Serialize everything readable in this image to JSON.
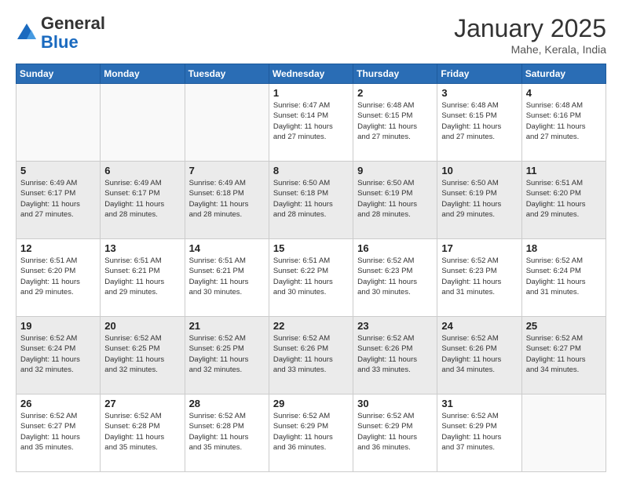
{
  "header": {
    "logo_general": "General",
    "logo_blue": "Blue",
    "month_title": "January 2025",
    "location": "Mahe, Kerala, India"
  },
  "days_of_week": [
    "Sunday",
    "Monday",
    "Tuesday",
    "Wednesday",
    "Thursday",
    "Friday",
    "Saturday"
  ],
  "weeks": [
    [
      {
        "day": "",
        "info": ""
      },
      {
        "day": "",
        "info": ""
      },
      {
        "day": "",
        "info": ""
      },
      {
        "day": "1",
        "info": "Sunrise: 6:47 AM\nSunset: 6:14 PM\nDaylight: 11 hours\nand 27 minutes."
      },
      {
        "day": "2",
        "info": "Sunrise: 6:48 AM\nSunset: 6:15 PM\nDaylight: 11 hours\nand 27 minutes."
      },
      {
        "day": "3",
        "info": "Sunrise: 6:48 AM\nSunset: 6:15 PM\nDaylight: 11 hours\nand 27 minutes."
      },
      {
        "day": "4",
        "info": "Sunrise: 6:48 AM\nSunset: 6:16 PM\nDaylight: 11 hours\nand 27 minutes."
      }
    ],
    [
      {
        "day": "5",
        "info": "Sunrise: 6:49 AM\nSunset: 6:17 PM\nDaylight: 11 hours\nand 27 minutes."
      },
      {
        "day": "6",
        "info": "Sunrise: 6:49 AM\nSunset: 6:17 PM\nDaylight: 11 hours\nand 28 minutes."
      },
      {
        "day": "7",
        "info": "Sunrise: 6:49 AM\nSunset: 6:18 PM\nDaylight: 11 hours\nand 28 minutes."
      },
      {
        "day": "8",
        "info": "Sunrise: 6:50 AM\nSunset: 6:18 PM\nDaylight: 11 hours\nand 28 minutes."
      },
      {
        "day": "9",
        "info": "Sunrise: 6:50 AM\nSunset: 6:19 PM\nDaylight: 11 hours\nand 28 minutes."
      },
      {
        "day": "10",
        "info": "Sunrise: 6:50 AM\nSunset: 6:19 PM\nDaylight: 11 hours\nand 29 minutes."
      },
      {
        "day": "11",
        "info": "Sunrise: 6:51 AM\nSunset: 6:20 PM\nDaylight: 11 hours\nand 29 minutes."
      }
    ],
    [
      {
        "day": "12",
        "info": "Sunrise: 6:51 AM\nSunset: 6:20 PM\nDaylight: 11 hours\nand 29 minutes."
      },
      {
        "day": "13",
        "info": "Sunrise: 6:51 AM\nSunset: 6:21 PM\nDaylight: 11 hours\nand 29 minutes."
      },
      {
        "day": "14",
        "info": "Sunrise: 6:51 AM\nSunset: 6:21 PM\nDaylight: 11 hours\nand 30 minutes."
      },
      {
        "day": "15",
        "info": "Sunrise: 6:51 AM\nSunset: 6:22 PM\nDaylight: 11 hours\nand 30 minutes."
      },
      {
        "day": "16",
        "info": "Sunrise: 6:52 AM\nSunset: 6:23 PM\nDaylight: 11 hours\nand 30 minutes."
      },
      {
        "day": "17",
        "info": "Sunrise: 6:52 AM\nSunset: 6:23 PM\nDaylight: 11 hours\nand 31 minutes."
      },
      {
        "day": "18",
        "info": "Sunrise: 6:52 AM\nSunset: 6:24 PM\nDaylight: 11 hours\nand 31 minutes."
      }
    ],
    [
      {
        "day": "19",
        "info": "Sunrise: 6:52 AM\nSunset: 6:24 PM\nDaylight: 11 hours\nand 32 minutes."
      },
      {
        "day": "20",
        "info": "Sunrise: 6:52 AM\nSunset: 6:25 PM\nDaylight: 11 hours\nand 32 minutes."
      },
      {
        "day": "21",
        "info": "Sunrise: 6:52 AM\nSunset: 6:25 PM\nDaylight: 11 hours\nand 32 minutes."
      },
      {
        "day": "22",
        "info": "Sunrise: 6:52 AM\nSunset: 6:26 PM\nDaylight: 11 hours\nand 33 minutes."
      },
      {
        "day": "23",
        "info": "Sunrise: 6:52 AM\nSunset: 6:26 PM\nDaylight: 11 hours\nand 33 minutes."
      },
      {
        "day": "24",
        "info": "Sunrise: 6:52 AM\nSunset: 6:26 PM\nDaylight: 11 hours\nand 34 minutes."
      },
      {
        "day": "25",
        "info": "Sunrise: 6:52 AM\nSunset: 6:27 PM\nDaylight: 11 hours\nand 34 minutes."
      }
    ],
    [
      {
        "day": "26",
        "info": "Sunrise: 6:52 AM\nSunset: 6:27 PM\nDaylight: 11 hours\nand 35 minutes."
      },
      {
        "day": "27",
        "info": "Sunrise: 6:52 AM\nSunset: 6:28 PM\nDaylight: 11 hours\nand 35 minutes."
      },
      {
        "day": "28",
        "info": "Sunrise: 6:52 AM\nSunset: 6:28 PM\nDaylight: 11 hours\nand 35 minutes."
      },
      {
        "day": "29",
        "info": "Sunrise: 6:52 AM\nSunset: 6:29 PM\nDaylight: 11 hours\nand 36 minutes."
      },
      {
        "day": "30",
        "info": "Sunrise: 6:52 AM\nSunset: 6:29 PM\nDaylight: 11 hours\nand 36 minutes."
      },
      {
        "day": "31",
        "info": "Sunrise: 6:52 AM\nSunset: 6:29 PM\nDaylight: 11 hours\nand 37 minutes."
      },
      {
        "day": "",
        "info": ""
      }
    ]
  ]
}
